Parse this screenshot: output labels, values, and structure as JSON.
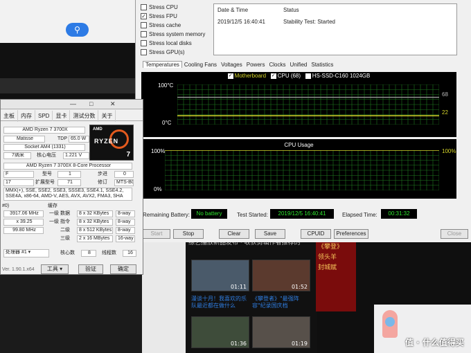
{
  "stress": {
    "options": [
      {
        "label": "Stress CPU",
        "checked": false
      },
      {
        "label": "Stress FPU",
        "checked": true
      },
      {
        "label": "Stress cache",
        "checked": false
      },
      {
        "label": "Stress system memory",
        "checked": false
      },
      {
        "label": "Stress local disks",
        "checked": false
      },
      {
        "label": "Stress GPU(s)",
        "checked": false
      }
    ],
    "log": {
      "col_date": "Date & Time",
      "col_status": "Status",
      "date": "2019/12/5 16:40:41",
      "status": "Stability Test: Started"
    },
    "tabs": [
      "Temperatures",
      "Cooling Fans",
      "Voltages",
      "Powers",
      "Clocks",
      "Unified",
      "Statistics"
    ],
    "active_tab": "Temperatures",
    "legend": [
      "Motherboard",
      "CPU (68)",
      "HS-SSD-C160 1024GB"
    ],
    "temp_chart": {
      "top": "100°C",
      "bottom": "0°C",
      "val1": "68",
      "val2": "22"
    },
    "usage_chart": {
      "title": "CPU Usage",
      "top_left": "100%",
      "bottom_left": "0%",
      "top_right": "100%"
    },
    "status": {
      "battery_label": "Remaining Battery:",
      "battery_value": "No battery",
      "started_label": "Test Started:",
      "started_value": "2019/12/5 16:40:41",
      "elapsed_label": "Elapsed Time:",
      "elapsed_value": "00:31:32"
    },
    "buttons": [
      "Start",
      "Stop",
      "Clear",
      "Save",
      "CPUID",
      "Preferences",
      "Close"
    ]
  },
  "chart_data": [
    {
      "type": "line",
      "title": "",
      "ylim": [
        0,
        100
      ],
      "yunit": "°C",
      "series": [
        {
          "name": "CPU (68)",
          "values": [
            68,
            68,
            68,
            68,
            68,
            68,
            68,
            68,
            68,
            68,
            68,
            68
          ]
        },
        {
          "name": "Motherboard",
          "values": [
            22,
            22,
            22,
            22,
            22,
            22,
            22,
            22,
            22,
            22,
            22,
            22
          ]
        }
      ]
    },
    {
      "type": "line",
      "title": "CPU Usage",
      "ylim": [
        0,
        100
      ],
      "yunit": "%",
      "series": [
        {
          "name": "CPU Usage",
          "values": [
            100,
            100,
            100,
            100,
            100,
            100,
            100,
            100,
            100,
            100,
            100,
            100
          ]
        }
      ]
    }
  ],
  "cpuz": {
    "title_buttons": [
      "—",
      "□",
      "✕"
    ],
    "tabs": [
      "主板",
      "内存",
      "SPD",
      "显卡",
      "测试分数",
      "关于"
    ],
    "name": "AMD Ryzen 7 3700X",
    "codename": "Matisse",
    "tdp_label": "TDP",
    "tdp": "65.0 W",
    "package": "Socket AM4 (1331)",
    "tech": "7纳米",
    "voltage_label": "核心电压",
    "voltage": "1.221 V",
    "spec": "AMD Ryzen 7 3700X 8-Core Processor",
    "family": "F",
    "model_label": "型号",
    "model": "1",
    "stepping_label": "步进",
    "stepping": "0",
    "ext_family": "17",
    "ext_model_label": "扩展型号",
    "ext_model": "71",
    "revision_label": "修订",
    "revision": "MTS-B0",
    "instructions": "MMX(+), SSE, SSE2, SSE3, SSSE3, SSE4.1, SSE4.2, SSE4A, x86-64, AMD-V, AES, AVX, AVX2, FMA3, SHA",
    "clock_section": "#0)",
    "core_speed": "3917.06 MHz",
    "multiplier": "x 39.25",
    "bus_speed": "99.80 MHz",
    "cache_title": "缓存",
    "cache": [
      {
        "label": "一级 数据",
        "size": "8 x 32 KBytes",
        "way": "8-way"
      },
      {
        "label": "一级 指令",
        "size": "8 x 32 KBytes",
        "way": "8-way"
      },
      {
        "label": "二级",
        "size": "8 x 512 KBytes",
        "way": "8-way"
      },
      {
        "label": "三级",
        "size": "2 x 16 MBytes",
        "way": "16-way"
      }
    ],
    "processor_select": "处理器 #1",
    "cores_label": "核心数",
    "cores": "8",
    "threads_label": "线程数",
    "threads": "16",
    "version": "Ver. 1.90.1.x64",
    "tools": "工具",
    "validate": "验证",
    "ok": "确定",
    "logo_brand": "AMD",
    "logo_name": "RYZEN",
    "logo_num": "7"
  },
  "feed": {
    "header": "综艺播放新品发布 · 收获剪辑作者推荐的",
    "items": [
      {
        "duration": "01:11",
        "caption": "漫谈十月！我喜欢的乐队最近都在做什么"
      },
      {
        "duration": "01:52",
        "caption": "《攀登者》\"最强阵容\"纪录国庆档"
      },
      {
        "duration": "01:36",
        "caption": ""
      },
      {
        "duration": "01:19",
        "caption": ""
      }
    ],
    "ad_lines": [
      "《攀登》",
      "领头羊",
      "封城赋"
    ]
  },
  "watermark": "值 · 什么值得买",
  "colors": {
    "accent": "#2c6bd0",
    "chart_grid": "#1f7a1f",
    "cpu_line": "#9a9a9a",
    "mb_line": "#d6d62a",
    "usage_line": "#d6d62a",
    "lcd_text": "#2ee82e"
  }
}
